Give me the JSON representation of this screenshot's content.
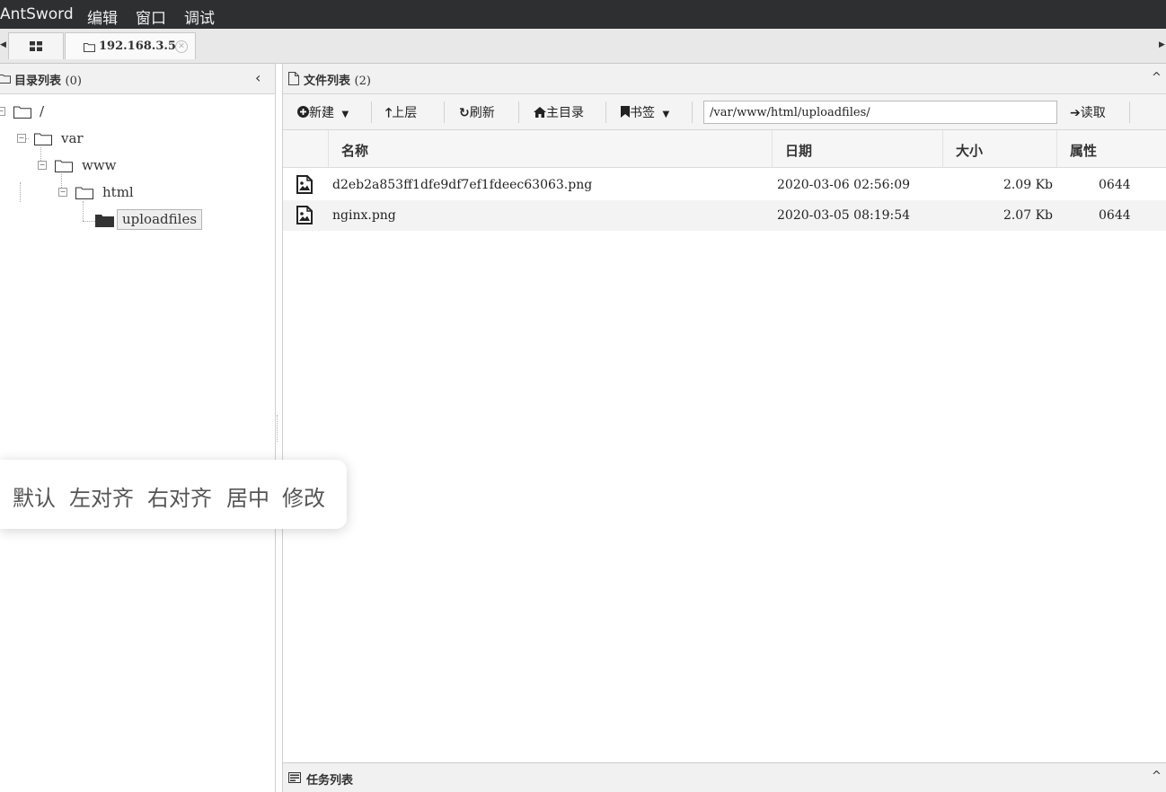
{
  "menubar": {
    "app_name": "AntSword",
    "edit": "编辑",
    "window": "窗口",
    "debug": "调试"
  },
  "tabs": {
    "active_tab_title": "192.168.3.5"
  },
  "left_panel": {
    "title": "目录列表",
    "count": "(0)",
    "tree": [
      {
        "label": "/"
      },
      {
        "label": "var"
      },
      {
        "label": "www"
      },
      {
        "label": "html"
      },
      {
        "label": "uploadfiles",
        "selected": true
      }
    ]
  },
  "right_panel": {
    "title": "文件列表",
    "count": "(2)",
    "toolbar": {
      "new": "新建",
      "up": "上层",
      "refresh": "刷新",
      "home": "主目录",
      "bookmarks": "书签",
      "path": "/var/www/html/uploadfiles/",
      "read": "读取"
    },
    "columns": {
      "name": "名称",
      "date": "日期",
      "size": "大小",
      "attr": "属性"
    },
    "files": [
      {
        "name": "d2eb2a853ff1dfe9df7ef1fdeec63063.png",
        "date": "2020-03-06 02:56:09",
        "size": "2.09 Kb",
        "attr": "0644"
      },
      {
        "name": "nginx.png",
        "date": "2020-03-05 08:19:54",
        "size": "2.07 Kb",
        "attr": "0644"
      }
    ]
  },
  "task_panel": {
    "title": "任务列表"
  },
  "toast": {
    "options": [
      "默认",
      "左对齐",
      "右对齐",
      "居中",
      "修改"
    ]
  },
  "colors": {
    "menubar_bg": "#2d2f31",
    "panel_header_bg": "#f1f1f1",
    "alt_row_bg": "#f3f3f3"
  }
}
